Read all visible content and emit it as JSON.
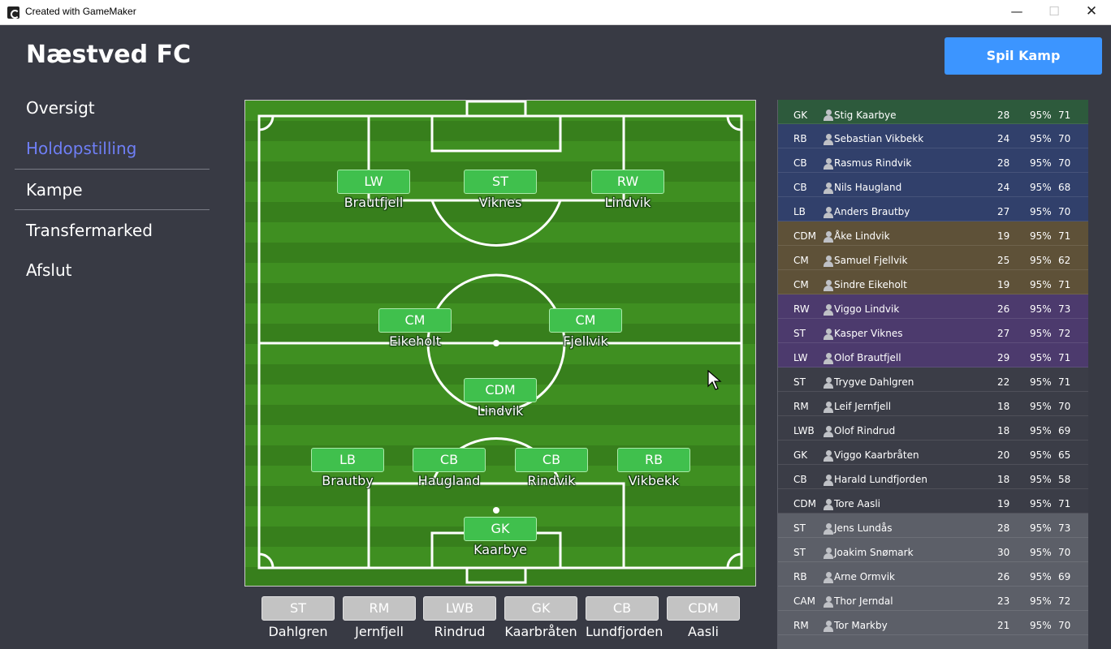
{
  "window": {
    "title": "Created with GameMaker",
    "min": "—",
    "max": "☐",
    "close": "✕"
  },
  "club": {
    "name": "Næstved FC"
  },
  "menu": [
    {
      "label": "Oversigt"
    },
    {
      "label": "Holdopstilling"
    },
    {
      "label": "Kampe"
    },
    {
      "label": "Transfermarked"
    },
    {
      "label": "Afslut"
    }
  ],
  "play_button": "Spil Kamp",
  "lineup": [
    {
      "pos": "LW",
      "name": "Brautfjell"
    },
    {
      "pos": "ST",
      "name": "Viknes"
    },
    {
      "pos": "RW",
      "name": "Lindvik"
    },
    {
      "pos": "CM",
      "name": "Eikeholt"
    },
    {
      "pos": "CM",
      "name": "Fjellvik"
    },
    {
      "pos": "CDM",
      "name": "Lindvik"
    },
    {
      "pos": "LB",
      "name": "Brautby"
    },
    {
      "pos": "CB",
      "name": "Haugland"
    },
    {
      "pos": "CB",
      "name": "Rindvik"
    },
    {
      "pos": "RB",
      "name": "Vikbekk"
    },
    {
      "pos": "GK",
      "name": "Kaarbye"
    }
  ],
  "bench": [
    {
      "pos": "ST",
      "name": "Dahlgren"
    },
    {
      "pos": "RM",
      "name": "Jernfjell"
    },
    {
      "pos": "LWB",
      "name": "Rindrud"
    },
    {
      "pos": "GK",
      "name": "Kaarbråten"
    },
    {
      "pos": "CB",
      "name": "Lundfjorden"
    },
    {
      "pos": "CDM",
      "name": "Aasli"
    }
  ],
  "squad": [
    {
      "pos": "GK",
      "name": "Stig Kaarbye",
      "age": "28",
      "cond": "95%",
      "rating": "71"
    },
    {
      "pos": "RB",
      "name": "Sebastian Vikbekk",
      "age": "24",
      "cond": "95%",
      "rating": "70"
    },
    {
      "pos": "CB",
      "name": "Rasmus Rindvik",
      "age": "28",
      "cond": "95%",
      "rating": "70"
    },
    {
      "pos": "CB",
      "name": "Nils Haugland",
      "age": "24",
      "cond": "95%",
      "rating": "68"
    },
    {
      "pos": "LB",
      "name": "Anders Brautby",
      "age": "27",
      "cond": "95%",
      "rating": "70"
    },
    {
      "pos": "CDM",
      "name": "Åke Lindvik",
      "age": "19",
      "cond": "95%",
      "rating": "71"
    },
    {
      "pos": "CM",
      "name": "Samuel Fjellvik",
      "age": "25",
      "cond": "95%",
      "rating": "62"
    },
    {
      "pos": "CM",
      "name": "Sindre Eikeholt",
      "age": "19",
      "cond": "95%",
      "rating": "71"
    },
    {
      "pos": "RW",
      "name": "Viggo Lindvik",
      "age": "26",
      "cond": "95%",
      "rating": "73"
    },
    {
      "pos": "ST",
      "name": "Kasper Viknes",
      "age": "27",
      "cond": "95%",
      "rating": "72"
    },
    {
      "pos": "LW",
      "name": "Olof Brautfjell",
      "age": "29",
      "cond": "95%",
      "rating": "71"
    },
    {
      "pos": "ST",
      "name": "Trygve Dahlgren",
      "age": "22",
      "cond": "95%",
      "rating": "71"
    },
    {
      "pos": "RM",
      "name": "Leif Jernfjell",
      "age": "18",
      "cond": "95%",
      "rating": "70"
    },
    {
      "pos": "LWB",
      "name": "Olof Rindrud",
      "age": "18",
      "cond": "95%",
      "rating": "69"
    },
    {
      "pos": "GK",
      "name": "Viggo Kaarbråten",
      "age": "20",
      "cond": "95%",
      "rating": "65"
    },
    {
      "pos": "CB",
      "name": "Harald Lundfjorden",
      "age": "18",
      "cond": "95%",
      "rating": "58"
    },
    {
      "pos": "CDM",
      "name": "Tore Aasli",
      "age": "19",
      "cond": "95%",
      "rating": "71"
    },
    {
      "pos": "ST",
      "name": "Jens Lundås",
      "age": "28",
      "cond": "95%",
      "rating": "73"
    },
    {
      "pos": "ST",
      "name": "Joakim Snømark",
      "age": "30",
      "cond": "95%",
      "rating": "70"
    },
    {
      "pos": "RB",
      "name": "Arne Ormvik",
      "age": "26",
      "cond": "95%",
      "rating": "69"
    },
    {
      "pos": "CAM",
      "name": "Thor Jerndal",
      "age": "23",
      "cond": "95%",
      "rating": "72"
    },
    {
      "pos": "RM",
      "name": "Tor Markby",
      "age": "21",
      "cond": "95%",
      "rating": "70"
    }
  ],
  "colors": {
    "accent": "#3c95ff",
    "menu_active": "#6f7ff6",
    "position_button": "#40c04d",
    "bench_button": "#c3c3c3",
    "group_gk": "#2d5a3c",
    "group_defence": "#31406b",
    "group_midfield": "#5e5138",
    "group_attack": "#4c3a6d",
    "group_reserves": "#5c5f68"
  }
}
